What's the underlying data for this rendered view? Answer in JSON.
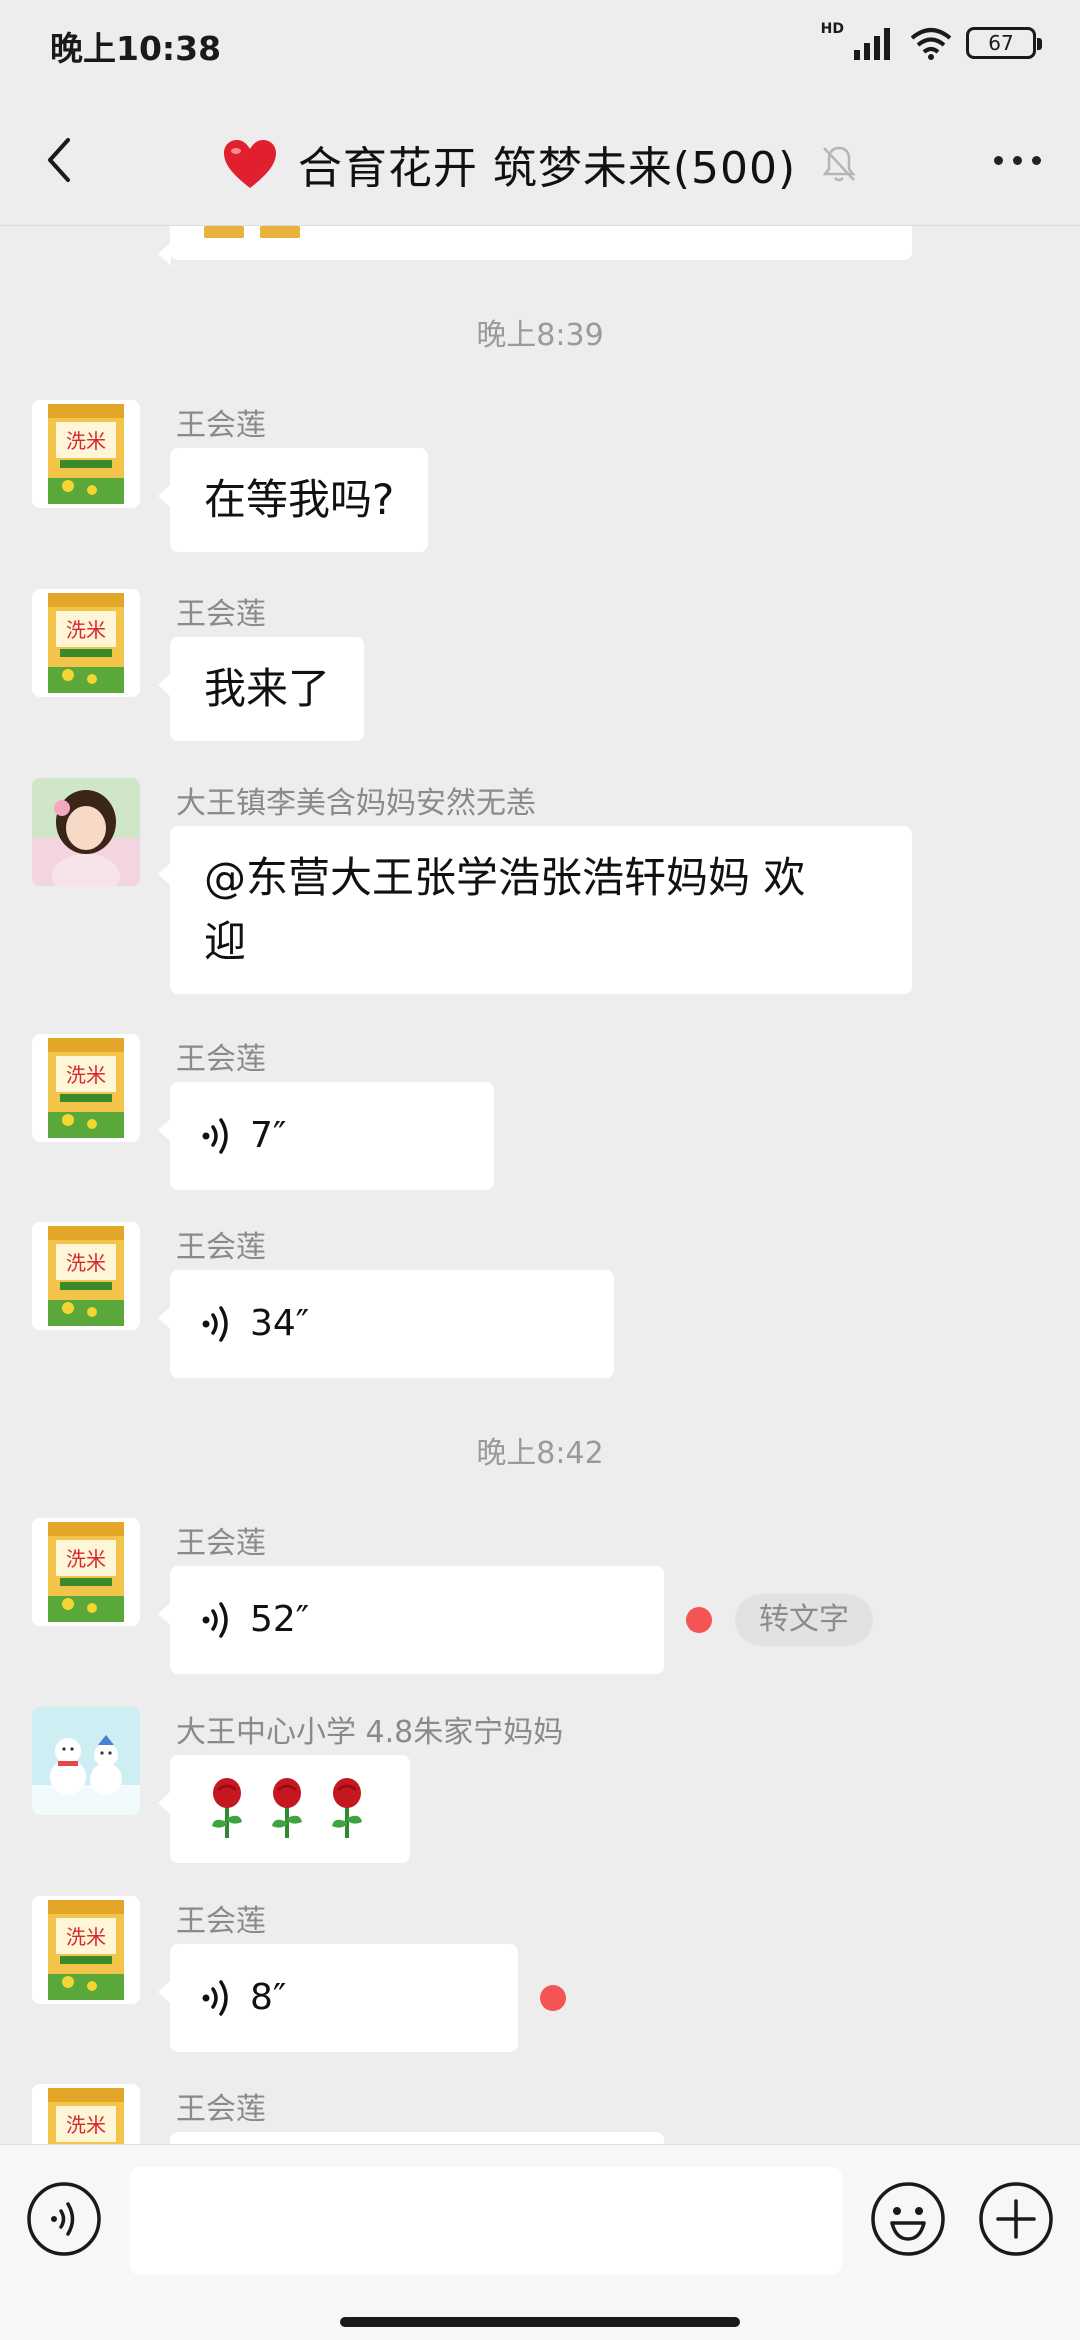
{
  "status_bar": {
    "time": "晚上10:38",
    "network": "HD",
    "battery": "67"
  },
  "header": {
    "title": "合育花开 筑梦未来(500)",
    "icons": [
      "back-arrow-icon",
      "heart-icon",
      "mute-bell-icon",
      "more-dots-icon"
    ]
  },
  "timestamps": [
    "晚上8:39",
    "晚上8:42"
  ],
  "messages": [
    {
      "sender": "王会莲",
      "type": "text",
      "text": "在等我吗?"
    },
    {
      "sender": "王会莲",
      "type": "text",
      "text": "我来了"
    },
    {
      "sender": "大王镇李美含妈妈安然无恙",
      "type": "text",
      "text_line1": "@东营大王张学浩张浩轩妈妈  欢",
      "text_line2": "迎"
    },
    {
      "sender": "王会莲",
      "type": "voice",
      "duration": "7″"
    },
    {
      "sender": "王会莲",
      "type": "voice",
      "duration": "34″"
    },
    {
      "sender": "王会莲",
      "type": "voice",
      "duration": "52″",
      "unread": true,
      "convert_label": "转文字"
    },
    {
      "sender": "大王中心小学 4.8朱家宁妈妈",
      "type": "emoji",
      "emoji": [
        "rose-icon",
        "rose-icon",
        "rose-icon"
      ]
    },
    {
      "sender": "王会莲",
      "type": "voice",
      "duration": "8″",
      "unread": true
    },
    {
      "sender": "王会莲",
      "type": "partial"
    }
  ],
  "input_bar": {
    "placeholder": "",
    "icons": [
      "voice-input-icon",
      "emoji-icon",
      "plus-icon"
    ]
  },
  "colors": {
    "background": "#ededed",
    "bubble": "#ffffff",
    "unread_dot": "#f45454",
    "sender_name": "#8a8a8a"
  }
}
